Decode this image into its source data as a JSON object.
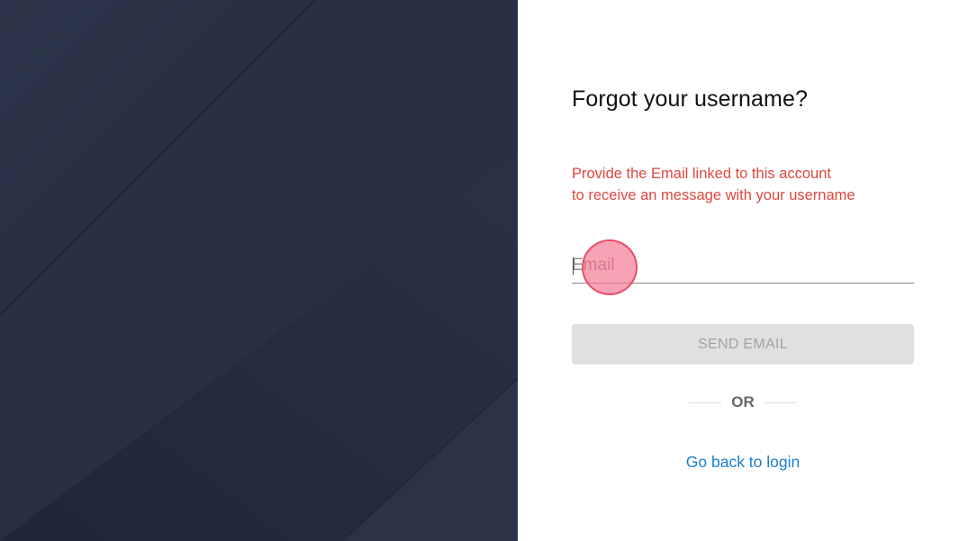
{
  "form": {
    "title": "Forgot your username?",
    "instructions": [
      "Provide the Email linked to this account",
      "to receive an message with your username"
    ],
    "email_placeholder": "Email",
    "email_value": "",
    "send_button_label": "SEND EMAIL",
    "send_button_state": "disabled",
    "divider_label": "OR",
    "back_link_label": "Go back to login"
  },
  "theme": {
    "left_panel_color": "#283146",
    "instruction_color": "#e0463f",
    "link_color": "#1a7fd1",
    "button_disabled_bg": "#e0e0e0"
  }
}
